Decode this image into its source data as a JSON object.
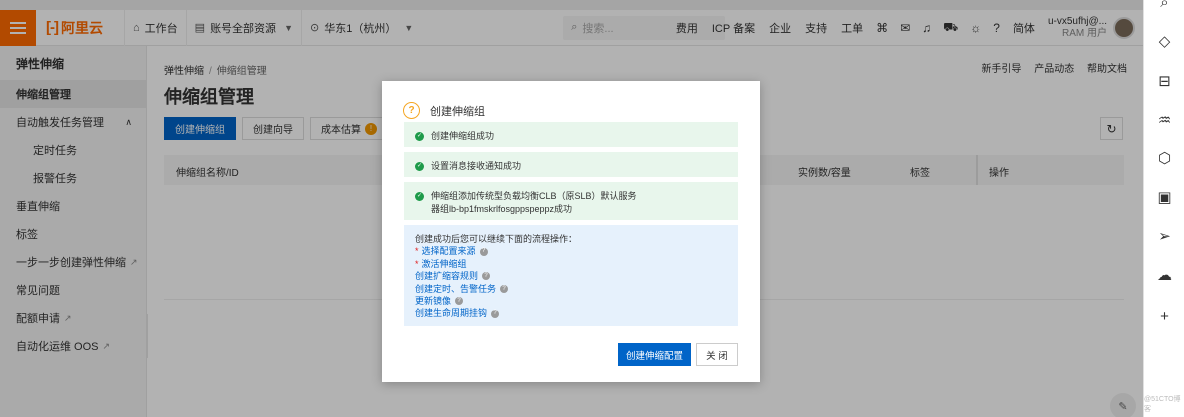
{
  "topbar": {
    "logo_text": "阿里云",
    "workbench": "工作台",
    "account_scope": "账号全部资源",
    "region": "华东1（杭州）",
    "search_placeholder": "搜索...",
    "links": [
      "费用",
      "ICP 备案",
      "企业",
      "支持",
      "工单"
    ],
    "language": "简体",
    "user_name": "u-vx5ufhj@...",
    "user_role": "RAM 用户"
  },
  "sidebar": {
    "title": "弹性伸缩",
    "items": [
      {
        "label": "伸缩组管理"
      },
      {
        "label": "自动触发任务管理"
      },
      {
        "label": "定时任务"
      },
      {
        "label": "报警任务"
      },
      {
        "label": "垂直伸缩"
      },
      {
        "label": "标签"
      },
      {
        "label": "一步一步创建弹性伸缩"
      },
      {
        "label": "常见问题"
      },
      {
        "label": "配额申请"
      },
      {
        "label": "自动化运维 OOS"
      }
    ]
  },
  "main": {
    "breadcrumb": [
      "弹性伸缩",
      "伸缩组管理"
    ],
    "links": [
      "新手引导",
      "产品动态",
      "帮助文档"
    ],
    "title": "伸缩组管理",
    "buttons": {
      "create": "创建伸缩组",
      "wizard": "创建向导",
      "estimate": "成本估算",
      "badge": "!"
    },
    "columns": {
      "name": "伸缩组名称/ID",
      "instances": "实例数/容量",
      "tags": "标签",
      "actions": "操作"
    }
  },
  "modal": {
    "title": "创建伸缩组",
    "messages": [
      "创建伸缩组成功",
      "设置消息接收通知成功",
      "伸缩组添加传统型负载均衡CLB（原SLB）默认服务器组lb-bp1fmskrlfosgppspeppz成功"
    ],
    "next_lead": "创建成功后您可以继续下面的流程操作：",
    "next_steps": [
      {
        "label": "选择配置来源",
        "required": true
      },
      {
        "label": "激活伸缩组",
        "required": true
      },
      {
        "label": "创建扩缩容规则",
        "required": false
      },
      {
        "label": "创建定时、告警任务",
        "required": false
      },
      {
        "label": "更新镜像",
        "required": false
      },
      {
        "label": "创建生命周期挂钩",
        "required": false
      }
    ],
    "required_mark": "*",
    "primary_button": "创建伸缩配置",
    "close_button": "关 闭"
  },
  "watermark": "@51CTO博客"
}
